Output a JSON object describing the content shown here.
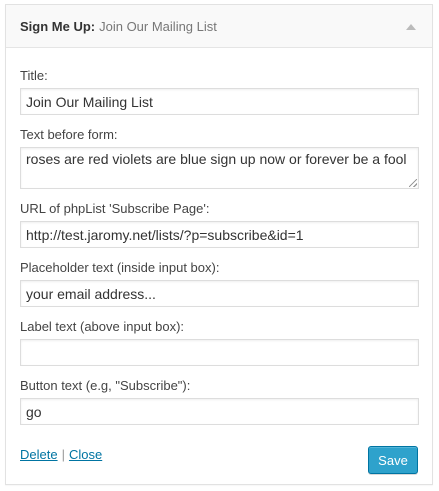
{
  "widget": {
    "title_prefix": "Sign Me Up:",
    "title_suffix": "Join Our Mailing List"
  },
  "fields": {
    "title": {
      "label": "Title:",
      "value": "Join Our Mailing List"
    },
    "text_before_form": {
      "label": "Text before form:",
      "value": "roses are red violets are blue sign up now or forever be a fool"
    },
    "subscribe_url": {
      "label": "URL of phpList 'Subscribe Page':",
      "value": "http://test.jaromy.net/lists/?p=subscribe&id=1"
    },
    "placeholder_text": {
      "label": "Placeholder text (inside input box):",
      "value": "your email address..."
    },
    "label_text": {
      "label": "Label text (above input box):",
      "value": ""
    },
    "button_text": {
      "label": "Button text (e.g, \"Subscribe\"):",
      "value": "go"
    }
  },
  "footer": {
    "delete_label": "Delete",
    "separator": "|",
    "close_label": "Close",
    "save_label": "Save"
  },
  "colors": {
    "link": "#0074a2",
    "primary_button": "#2ea2cc",
    "primary_button_border": "#0074a2"
  }
}
